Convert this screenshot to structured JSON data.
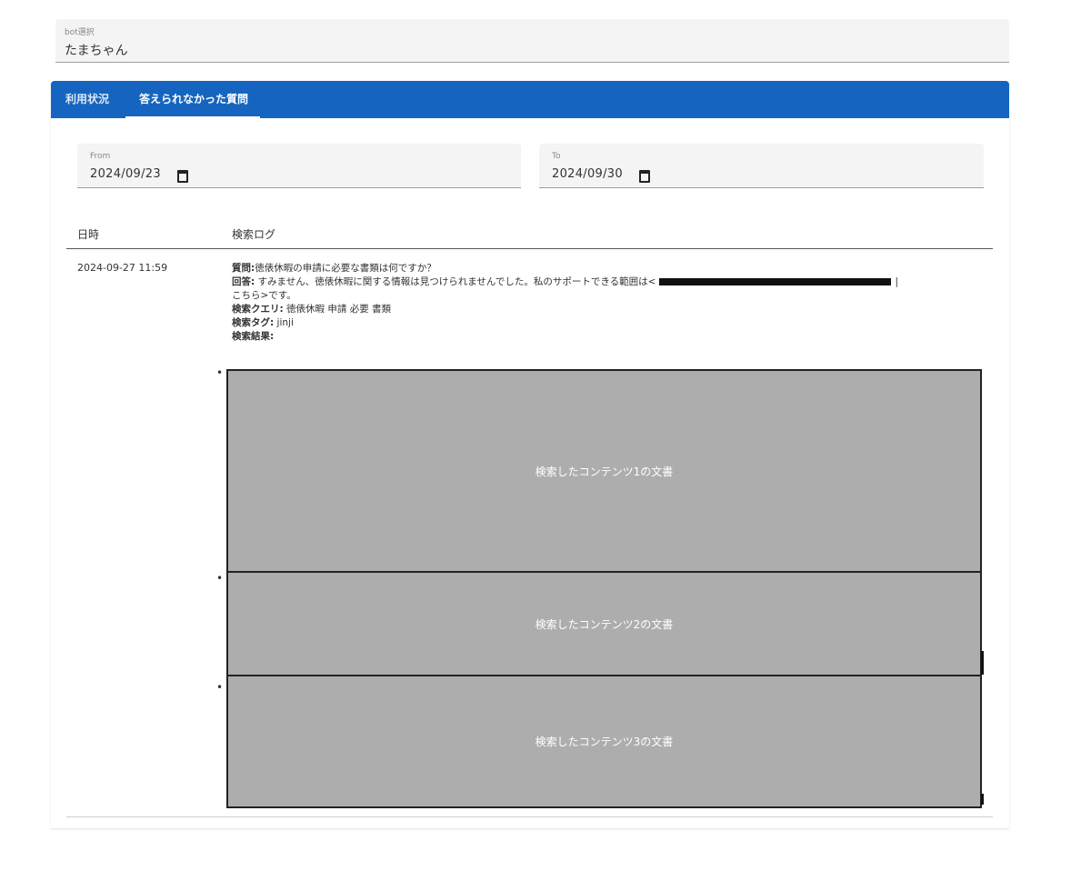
{
  "bot_select": {
    "label": "bot選択",
    "value": "たまちゃん"
  },
  "tabs": [
    {
      "label": "利用状況",
      "active": false
    },
    {
      "label": "答えられなかった質問",
      "active": true
    }
  ],
  "date_range": {
    "from": {
      "label": "From",
      "value": "2024/09/23"
    },
    "to": {
      "label": "To",
      "value": "2024/09/30"
    }
  },
  "table": {
    "headers": [
      "日時",
      "検索ログ"
    ],
    "rows": [
      {
        "datetime": "2024-09-27 11:59",
        "question_label": "質問:",
        "question": "徳俵休暇の申請に必要な書類は何ですか？",
        "answer_label": "回答:",
        "answer_before": "すみません、徳俵休暇に関する情報は見つけられませんでした。私のサポートできる範囲は<",
        "answer_after": "|",
        "answer_line2": "こちら>です。",
        "query_label": "検索クエリ:",
        "query": "徳俵休暇 申請 必要 書類",
        "tag_label": "検索タグ:",
        "tag": "jinji",
        "result_label": "検索結果:",
        "results": [
          "検索したコンテンツ1の文書",
          "検索したコンテンツ2の文書",
          "検索したコンテンツ3の文書"
        ]
      }
    ]
  },
  "colors": {
    "tab_bar": "#1565c0",
    "doc_placeholder": "#adadad"
  }
}
